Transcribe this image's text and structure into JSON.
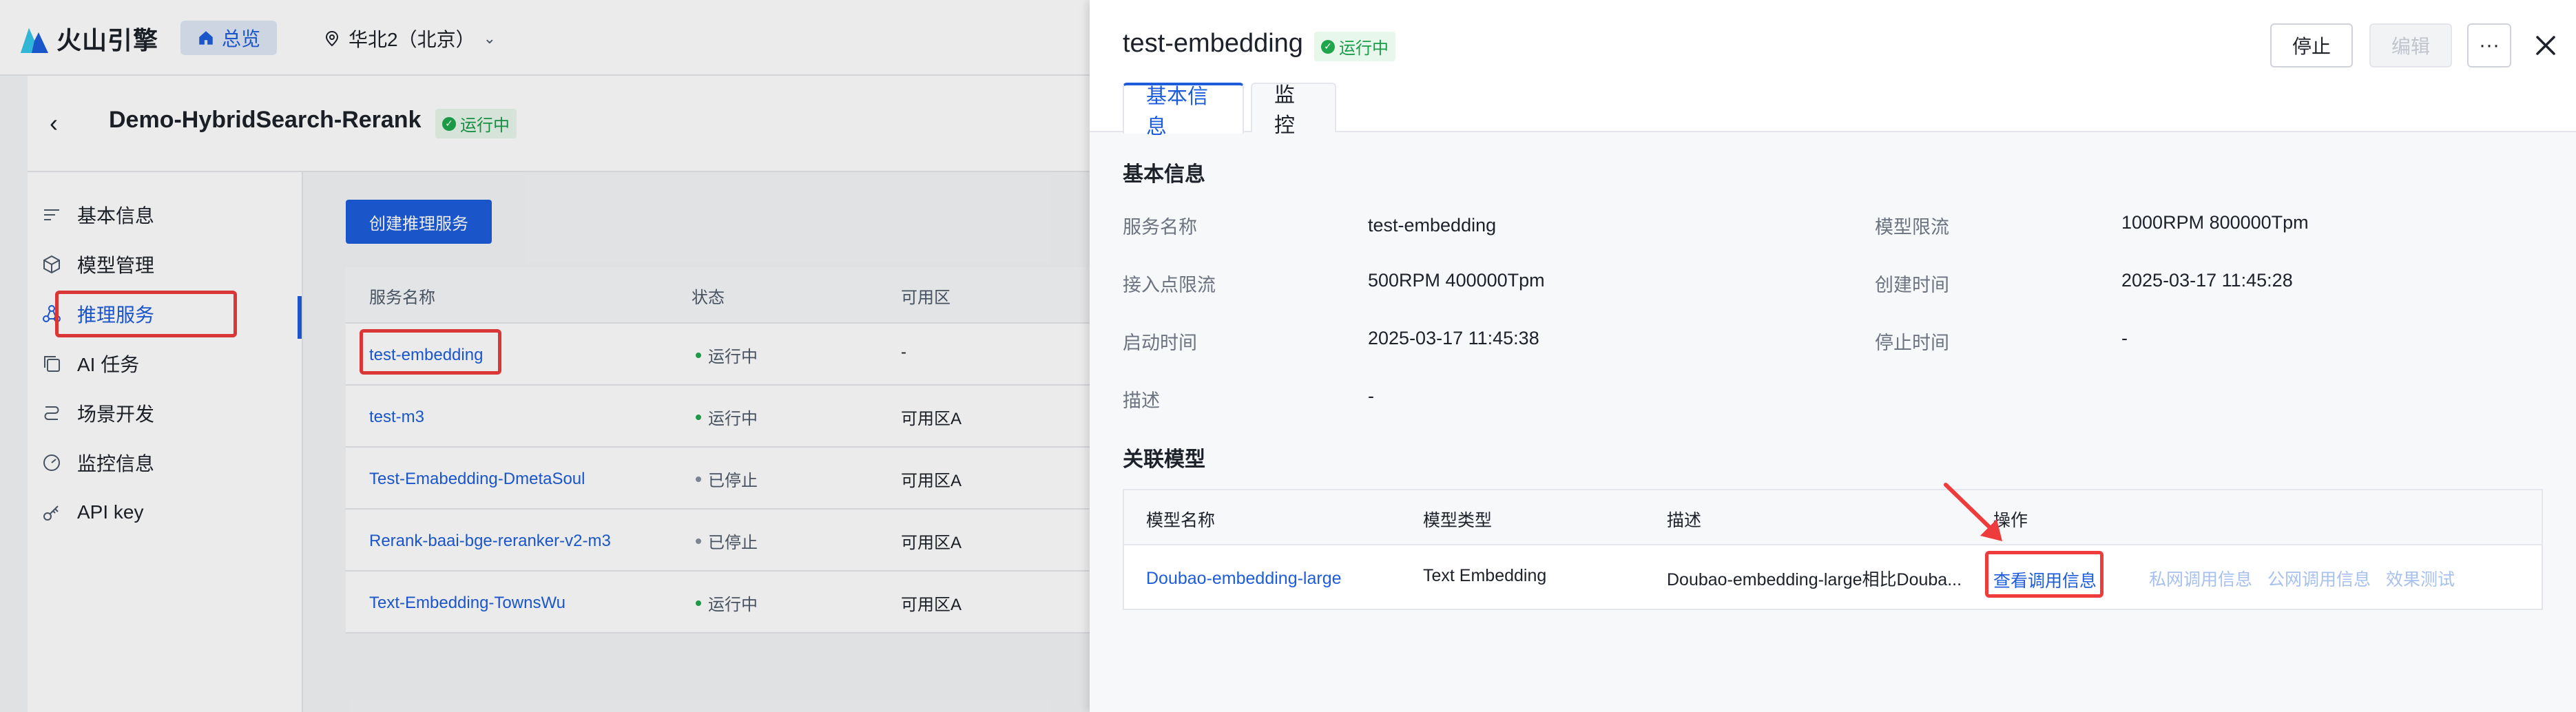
{
  "header": {
    "brand": "火山引擎",
    "home_label": "总览",
    "region": "华北2（北京）"
  },
  "project": {
    "title": "Demo-HybridSearch-Rerank",
    "status": "运行中"
  },
  "sidebar": {
    "items": [
      {
        "label": "基本信息",
        "icon": "list-icon"
      },
      {
        "label": "模型管理",
        "icon": "cube-icon"
      },
      {
        "label": "推理服务",
        "icon": "nodes-icon"
      },
      {
        "label": "AI 任务",
        "icon": "copy-icon"
      },
      {
        "label": "场景开发",
        "icon": "route-icon"
      },
      {
        "label": "监控信息",
        "icon": "gauge-icon"
      },
      {
        "label": "API key",
        "icon": "key-icon"
      }
    ]
  },
  "services": {
    "create_label": "创建推理服务",
    "columns": [
      "服务名称",
      "状态",
      "可用区"
    ],
    "rows": [
      {
        "name": "test-embedding",
        "status": "运行中",
        "zone": "-"
      },
      {
        "name": "test-m3",
        "status": "运行中",
        "zone": "可用区A"
      },
      {
        "name": "Test-Emabedding-DmetaSoul",
        "status": "已停止",
        "zone": "可用区A"
      },
      {
        "name": "Rerank-baai-bge-reranker-v2-m3",
        "status": "已停止",
        "zone": "可用区A"
      },
      {
        "name": "Text-Embedding-TownsWu",
        "status": "运行中",
        "zone": "可用区A"
      }
    ]
  },
  "drawer": {
    "title": "test-embedding",
    "status": "运行中",
    "actions": {
      "stop": "停止",
      "edit": "编辑",
      "more": "···"
    },
    "tabs": [
      "基本信息",
      "监控"
    ],
    "basic_title": "基本信息",
    "fields": {
      "service_name": {
        "label": "服务名称",
        "value": "test-embedding"
      },
      "model_rate": {
        "label": "模型限流",
        "value": "1000RPM 800000Tpm"
      },
      "endpoint_rate": {
        "label": "接入点限流",
        "value": "500RPM 400000Tpm"
      },
      "created_at": {
        "label": "创建时间",
        "value": "2025-03-17 11:45:28"
      },
      "started_at": {
        "label": "启动时间",
        "value": "2025-03-17 11:45:38"
      },
      "stopped_at": {
        "label": "停止时间",
        "value": "-"
      },
      "description": {
        "label": "描述",
        "value": "-"
      }
    },
    "models_title": "关联模型",
    "model_table": {
      "columns": [
        "模型名称",
        "模型类型",
        "描述",
        "操作"
      ],
      "row": {
        "name": "Doubao-embedding-large",
        "type": "Text Embedding",
        "description": "Doubao-embedding-large相比Douba...",
        "actions": [
          "查看调用信息",
          "私网调用信息",
          "公网调用信息",
          "效果测试"
        ]
      }
    }
  },
  "colors": {
    "accent": "#1d5ddb",
    "running": "#1fa64d",
    "highlight": "#ee3b3b"
  }
}
